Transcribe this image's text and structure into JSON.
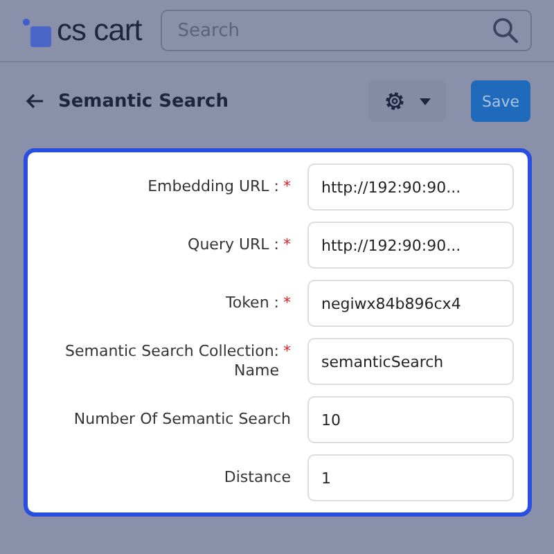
{
  "header": {
    "logo": "cs cart",
    "search": {
      "placeholder": "Search"
    }
  },
  "toolbar": {
    "title": "Semantic Search",
    "save": "Save"
  },
  "fields": [
    {
      "label": "Embedding URL :",
      "mark": "*",
      "value": "http://192:90:90..."
    },
    {
      "label": "Query URL :",
      "mark": "*",
      "value": "http://192:90:90..."
    },
    {
      "label": "Token :",
      "mark": "*",
      "value": "negiwx84b896cx4"
    },
    {
      "label": "Semantic Search Collection: Name",
      "mark": "*",
      "value": "semanticSearch"
    },
    {
      "label": "Number Of Semantic Search",
      "value": "10"
    },
    {
      "label": "Distance",
      "value": "1"
    }
  ]
}
